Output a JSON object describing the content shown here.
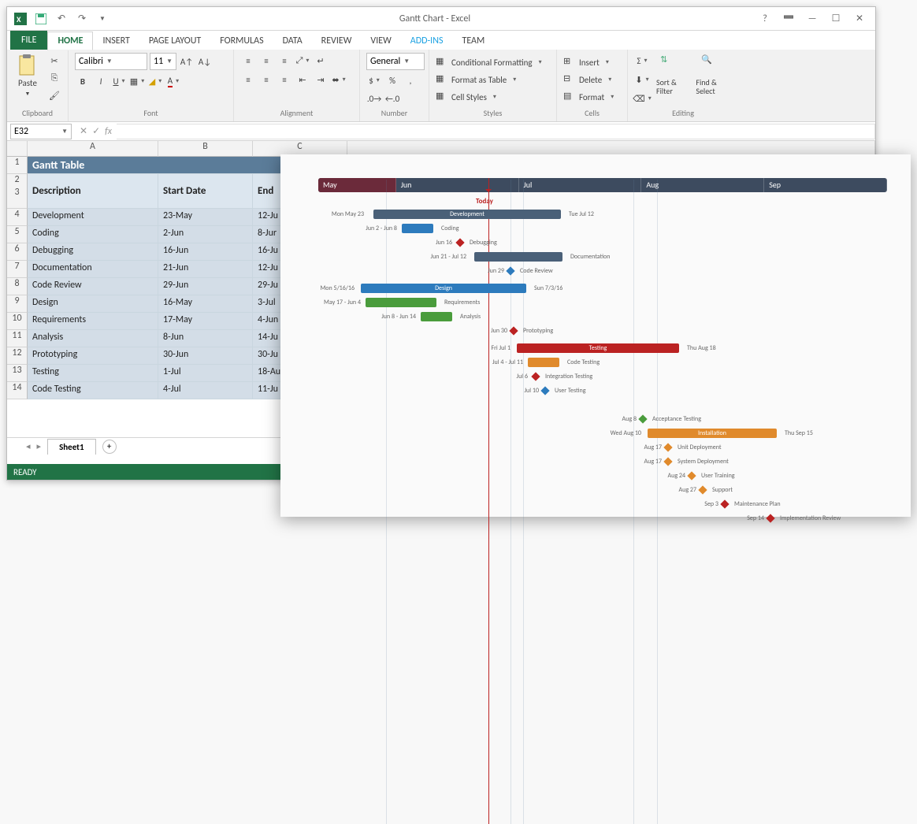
{
  "window": {
    "title": "Gantt Chart - Excel",
    "status": "READY"
  },
  "ribbon": {
    "tabs": {
      "file": "FILE",
      "home": "HOME",
      "insert": "INSERT",
      "page_layout": "PAGE LAYOUT",
      "formulas": "FORMULAS",
      "data": "DATA",
      "review": "REVIEW",
      "view": "VIEW",
      "addins": "ADD-INS",
      "team": "TEAM"
    },
    "groups": {
      "clipboard": "Clipboard",
      "font": "Font",
      "alignment": "Alignment",
      "number": "Number",
      "styles": "Styles",
      "cells": "Cells",
      "editing": "Editing"
    },
    "paste": "Paste",
    "font_name": "Calibri",
    "font_size": "11",
    "number_format": "General",
    "cond_fmt": "Conditional Formatting",
    "fmt_table": "Format as Table",
    "cell_styles": "Cell Styles",
    "insert": "Insert",
    "delete": "Delete",
    "format": "Format",
    "sort_filter": "Sort & Filter",
    "find_select": "Find & Select"
  },
  "formula_bar": {
    "name_box": "E32"
  },
  "columns": [
    "",
    "A",
    "B",
    "C"
  ],
  "table": {
    "title": "Gantt Table",
    "headers": {
      "desc": "Description",
      "start": "Start Date",
      "end": "End"
    },
    "rows": [
      {
        "n": "4",
        "desc": "Development",
        "start": "23-May",
        "end": "12-Ju"
      },
      {
        "n": "5",
        "desc": "Coding",
        "start": "2-Jun",
        "end": "8-Jur"
      },
      {
        "n": "6",
        "desc": "Debugging",
        "start": "16-Jun",
        "end": "16-Ju"
      },
      {
        "n": "7",
        "desc": "Documentation",
        "start": "21-Jun",
        "end": "12-Ju"
      },
      {
        "n": "8",
        "desc": "Code Review",
        "start": "29-Jun",
        "end": "29-Ju"
      },
      {
        "n": "9",
        "desc": "Design",
        "start": "16-May",
        "end": "3-Jul"
      },
      {
        "n": "10",
        "desc": "Requirements",
        "start": "17-May",
        "end": "4-Jun"
      },
      {
        "n": "11",
        "desc": "Analysis",
        "start": "8-Jun",
        "end": "14-Ju"
      },
      {
        "n": "12",
        "desc": "Prototyping",
        "start": "30-Jun",
        "end": "30-Ju"
      },
      {
        "n": "13",
        "desc": "Testing",
        "start": "1-Jul",
        "end": "18-Au"
      },
      {
        "n": "14",
        "desc": "Code Testing",
        "start": "4-Jul",
        "end": "11-Ju"
      }
    ]
  },
  "sheet": {
    "name": "Sheet1"
  },
  "gantt": {
    "months": {
      "may": "May",
      "jun": "Jun",
      "jul": "Jul",
      "aug": "Aug",
      "sep": "Sep"
    },
    "today": "Today",
    "bars": {
      "development": {
        "label": "Development",
        "left_txt": "Mon May 23",
        "right_txt": "Tue Jul 12"
      },
      "coding": {
        "label": "Coding",
        "left_txt": "Jun 2 - Jun 8"
      },
      "debugging": {
        "label": "Debugging",
        "left_txt": "Jun 16"
      },
      "documentation": {
        "label": "Documentation",
        "left_txt": "Jun 21 - Jul 12"
      },
      "code_review": {
        "label": "Code Review",
        "left_txt": "Jun 29"
      },
      "design": {
        "label": "Design",
        "left_txt": "Mon 5/16/16",
        "right_txt": "Sun 7/3/16"
      },
      "requirements": {
        "label": "Requirements",
        "left_txt": "May 17 - Jun 4"
      },
      "analysis": {
        "label": "Analysis",
        "left_txt": "Jun 8 - Jun 14"
      },
      "prototyping": {
        "label": "Prototyping",
        "left_txt": "Jun 30"
      },
      "testing": {
        "label": "Testing",
        "left_txt": "Fri Jul 1",
        "right_txt": "Thu Aug 18"
      },
      "code_testing": {
        "label": "Code Testing",
        "left_txt": "Jul 4 - Jul 11"
      },
      "integration_testing": {
        "label": "Integration Testing",
        "left_txt": "Jul 6"
      },
      "user_testing": {
        "label": "User Testing",
        "left_txt": "Jul 10"
      },
      "acceptance_testing": {
        "label": "Acceptance Testing",
        "left_txt": "Aug 8"
      },
      "installation": {
        "label": "Installation",
        "left_txt": "Wed Aug 10",
        "right_txt": "Thu Sep 15"
      },
      "unit_deployment": {
        "label": "Unit Deployment",
        "left_txt": "Aug 17"
      },
      "system_deployment": {
        "label": "System Deployment",
        "left_txt": "Aug 17"
      },
      "user_training": {
        "label": "User Training",
        "left_txt": "Aug 24"
      },
      "support": {
        "label": "Support",
        "left_txt": "Aug 27"
      },
      "maintenance_plan": {
        "label": "Maintenance Plan",
        "left_txt": "Sep 3"
      },
      "implementation_review": {
        "label": "Implementation Review",
        "left_txt": "Sep 14"
      }
    }
  },
  "chart_data": {
    "type": "gantt",
    "title": "Gantt Chart",
    "x_axis": {
      "type": "date",
      "start": "2016-05-01",
      "end": "2016-09-30",
      "ticks": [
        "May",
        "Jun",
        "Jul",
        "Aug",
        "Sep"
      ]
    },
    "today": "2016-06-20",
    "groups": [
      {
        "name": "Development",
        "start": "2016-05-23",
        "end": "2016-07-12",
        "color": "#4a6078",
        "tasks": [
          {
            "name": "Coding",
            "start": "2016-06-02",
            "end": "2016-06-08",
            "color": "#2d7bbd"
          },
          {
            "name": "Debugging",
            "date": "2016-06-16",
            "type": "milestone",
            "color": "#b22"
          },
          {
            "name": "Documentation",
            "start": "2016-06-21",
            "end": "2016-07-12",
            "color": "#4a6078"
          },
          {
            "name": "Code Review",
            "date": "2016-06-29",
            "type": "milestone",
            "color": "#2d7bbd"
          }
        ]
      },
      {
        "name": "Design",
        "start": "2016-05-16",
        "end": "2016-07-03",
        "color": "#2d7bbd",
        "tasks": [
          {
            "name": "Requirements",
            "start": "2016-05-17",
            "end": "2016-06-04",
            "color": "#4a9c3c"
          },
          {
            "name": "Analysis",
            "start": "2016-06-08",
            "end": "2016-06-14",
            "color": "#4a9c3c"
          },
          {
            "name": "Prototyping",
            "date": "2016-06-30",
            "type": "milestone",
            "color": "#b22"
          }
        ]
      },
      {
        "name": "Testing",
        "start": "2016-07-01",
        "end": "2016-08-18",
        "color": "#b22",
        "tasks": [
          {
            "name": "Code Testing",
            "start": "2016-07-04",
            "end": "2016-07-11",
            "color": "#e08a2c"
          },
          {
            "name": "Integration Testing",
            "date": "2016-07-06",
            "type": "milestone",
            "color": "#b22"
          },
          {
            "name": "User Testing",
            "date": "2016-07-10",
            "type": "milestone",
            "color": "#2d7bbd"
          },
          {
            "name": "Acceptance Testing",
            "date": "2016-08-08",
            "type": "milestone",
            "color": "#4a9c3c"
          }
        ]
      },
      {
        "name": "Installation",
        "start": "2016-08-10",
        "end": "2016-09-15",
        "color": "#e08a2c",
        "tasks": [
          {
            "name": "Unit Deployment",
            "date": "2016-08-17",
            "type": "milestone",
            "color": "#e08a2c"
          },
          {
            "name": "System Deployment",
            "date": "2016-08-17",
            "type": "milestone",
            "color": "#e08a2c"
          },
          {
            "name": "User Training",
            "date": "2016-08-24",
            "type": "milestone",
            "color": "#e08a2c"
          },
          {
            "name": "Support",
            "date": "2016-08-27",
            "type": "milestone",
            "color": "#e08a2c"
          },
          {
            "name": "Maintenance Plan",
            "date": "2016-09-03",
            "type": "milestone",
            "color": "#b22"
          },
          {
            "name": "Implementation Review",
            "date": "2016-09-14",
            "type": "milestone",
            "color": "#b22"
          }
        ]
      }
    ]
  }
}
